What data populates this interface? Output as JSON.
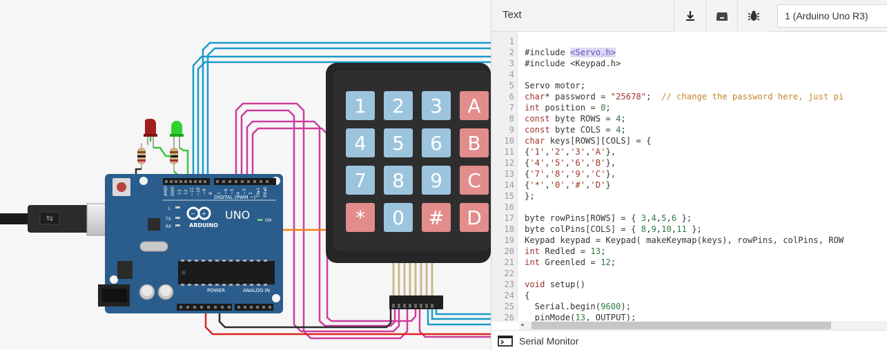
{
  "panel": {
    "title": "Text",
    "device": "1 (Arduino Uno R3)",
    "serial_monitor": "Serial Monitor",
    "icons": [
      "download-icon",
      "libraries-icon",
      "debugger-bug-icon"
    ]
  },
  "board": {
    "logo": "UNO",
    "brand": "ARDUINO",
    "digital_label": "DIGITAL (PWM ~)",
    "power_label": "POWER",
    "analog_label": "ANALOG IN",
    "on_label": "ON",
    "led_l": "L",
    "led_tx": "TX",
    "led_rx": "RX"
  },
  "keypad": {
    "keys": [
      "1",
      "2",
      "3",
      "A",
      "4",
      "5",
      "6",
      "B",
      "7",
      "8",
      "9",
      "C",
      "*",
      "0",
      "#",
      "D"
    ]
  },
  "colors": {
    "board": "#2a5d8c",
    "key_blue": "#9cc4dd",
    "key_red": "#e28c8c",
    "wire_blue": "#1a9acb",
    "wire_magenta": "#cc3c9c",
    "wire_red": "#dd2222",
    "wire_orange": "#ee7f1a",
    "led_red": "#a11e1e",
    "led_green": "#2ed12e"
  },
  "code": {
    "lines": [
      "",
      "#include <Servo.h>",
      "#include <Keypad.h>",
      "",
      "Servo motor;",
      "char* password = \"25678\";  // change the password here, just pi",
      "int position = 0;",
      "const byte ROWS = 4;",
      "const byte COLS = 4;",
      "char keys[ROWS][COLS] = {",
      "{'1','2','3','A'},",
      "{'4','5','6','B'},",
      "{'7','8','9','C'},",
      "{'*','0','#','D'}",
      "};",
      "",
      "byte rowPins[ROWS] = { 3,4,5,6 };",
      "byte colPins[COLS] = { 8,9,10,11 };",
      "Keypad keypad = Keypad( makeKeymap(keys), rowPins, colPins, ROW",
      "int Redled = 13;",
      "int Greenled = 12;",
      "",
      "void setup()",
      "{",
      "  Serial.begin(9600);",
      "  pinMode(13, OUTPUT);",
      ""
    ]
  }
}
